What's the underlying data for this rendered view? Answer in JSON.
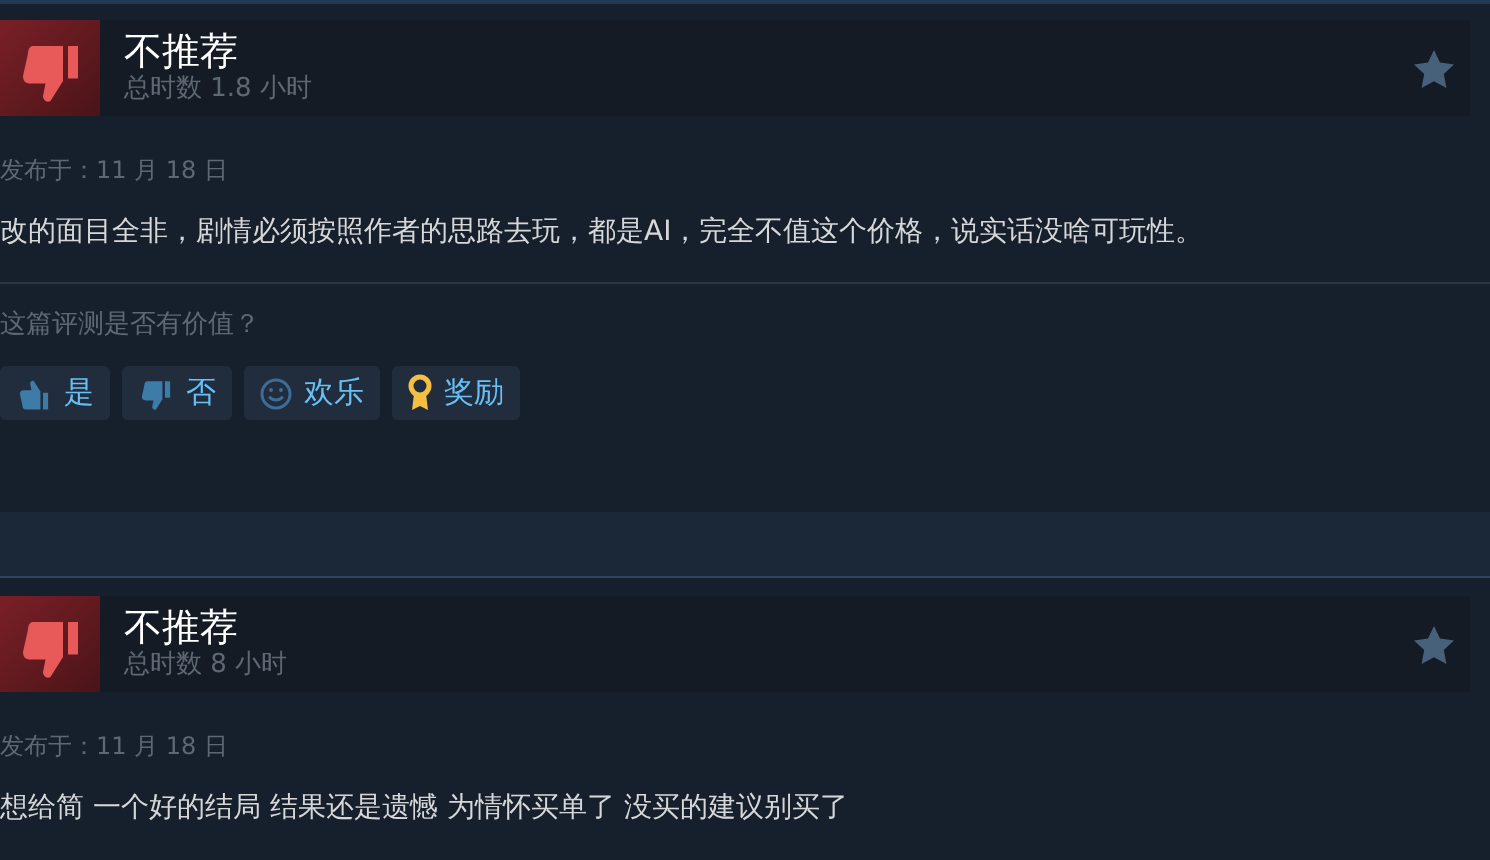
{
  "reviews": [
    {
      "verdict": "不推荐",
      "recommended": false,
      "playtime": "总时数 1.8 小时",
      "posted": "发布于：11 月 18 日",
      "text": "改的面目全非，剧情必须按照作者的思路去玩，都是AI，完全不值这个价格，说实话没啥可玩性。",
      "helpful_question": "这篇评测是否有价值？",
      "buttons": [
        {
          "kind": "yes",
          "label": "是"
        },
        {
          "kind": "no",
          "label": "否"
        },
        {
          "kind": "funny",
          "label": "欢乐"
        },
        {
          "kind": "award",
          "label": "奖励"
        }
      ]
    },
    {
      "verdict": "不推荐",
      "recommended": false,
      "playtime": "总时数 8 小时",
      "posted": "发布于：11 月 18 日",
      "text": "想给简 一个好的结局 结果还是遗憾 为情怀买单了 没买的建议别买了"
    }
  ]
}
